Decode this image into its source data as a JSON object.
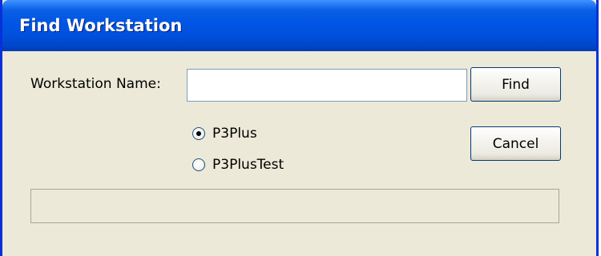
{
  "window": {
    "title": "Find Workstation"
  },
  "form": {
    "name_label": "Workstation Name:",
    "name_value": "",
    "find_label": "Find",
    "cancel_label": "Cancel",
    "radios": [
      {
        "label": "P3Plus",
        "checked": true
      },
      {
        "label": "P3PlusTest",
        "checked": false
      }
    ]
  },
  "status": {
    "text": ""
  },
  "colors": {
    "titlebar": "#0055e5",
    "window_background": "#ece9d8",
    "border": "#0831d9"
  }
}
